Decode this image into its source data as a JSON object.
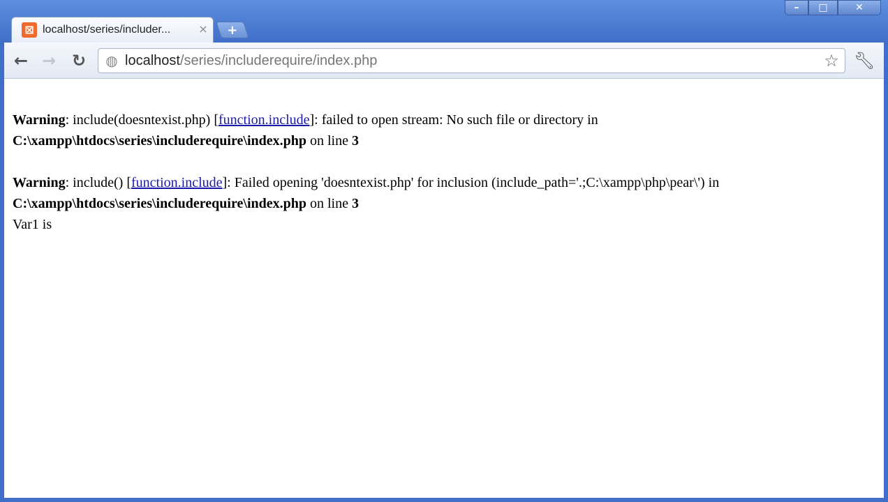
{
  "browser": {
    "tab": {
      "favicon": "xampp-icon",
      "title": "localhost/series/includer...",
      "close_label": "×"
    },
    "newtab_label": "+",
    "window_controls": {
      "minimize": "–",
      "maximize": "□",
      "close": "✕"
    },
    "nav": {
      "back": "←",
      "forward": "→",
      "reload": "↻"
    },
    "address": {
      "host": "localhost",
      "path": "/series/includerequire/index.php"
    },
    "icons": {
      "globe": "globe-icon",
      "star": "star-icon",
      "wrench": "wrench-icon"
    }
  },
  "page": {
    "warnings": [
      {
        "label": "Warning",
        "pre_link": ": include(doesntexist.php) [",
        "link": "function.include",
        "post_link": "]: failed to open stream: No such file or directory in",
        "file": "C:\\xampp\\htdocs\\series\\includerequire\\index.php",
        "on_line": " on line ",
        "line": "3"
      },
      {
        "label": "Warning",
        "pre_link": ": include() [",
        "link": "function.include",
        "post_link": "]: Failed opening 'doesntexist.php' for inclusion (include_path='.;C:\\xampp\\php\\pear\\') in",
        "file": "C:\\xampp\\htdocs\\series\\includerequire\\index.php",
        "on_line": " on line ",
        "line": "3"
      }
    ],
    "output_line": "Var1 is"
  },
  "colors": {
    "frame": "#4a75c4",
    "link": "#1a1aa8",
    "favicon": "#ef6b2d"
  }
}
